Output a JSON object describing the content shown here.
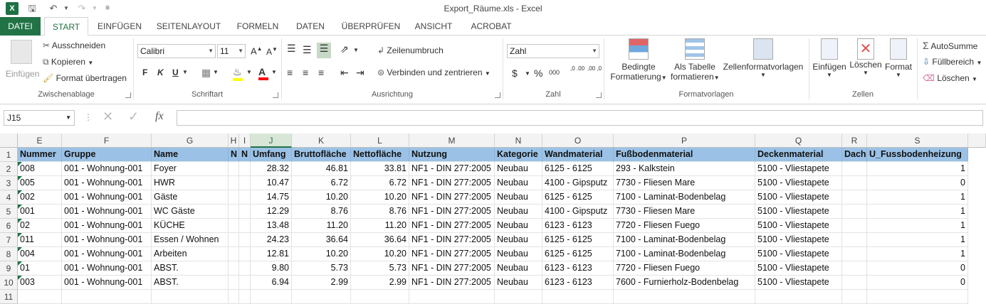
{
  "window": {
    "title": "Export_Räume.xls - Excel"
  },
  "tabs": [
    "DATEI",
    "START",
    "EINFÜGEN",
    "SEITENLAYOUT",
    "FORMELN",
    "DATEN",
    "ÜBERPRÜFEN",
    "ANSICHT",
    "ACROBAT"
  ],
  "ribbon": {
    "clipboard": {
      "paste": "Einfügen",
      "cut": "Ausschneiden",
      "copy": "Kopieren",
      "format_painter": "Format übertragen",
      "label": "Zwischenablage"
    },
    "font": {
      "name": "Calibri",
      "size": "11",
      "bold": "F",
      "italic": "K",
      "underline": "U",
      "label": "Schriftart"
    },
    "alignment": {
      "wrap": "Zeilenumbruch",
      "merge": "Verbinden und zentrieren",
      "label": "Ausrichtung"
    },
    "number": {
      "format": "Zahl",
      "currency": "$",
      "percent": "%",
      "thousands": "000",
      "inc_dec": ",0 .00",
      "dec_dec": ",00 ,0",
      "label": "Zahl"
    },
    "styles": {
      "cond_l1": "Bedingte",
      "cond_l2": "Formatierung",
      "table_l1": "Als Tabelle",
      "table_l2": "formatieren",
      "cell_styles": "Zellenformatvorlagen",
      "label": "Formatvorlagen"
    },
    "cells": {
      "insert": "Einfügen",
      "delete": "Löschen",
      "format": "Format",
      "label": "Zellen"
    },
    "editing": {
      "autosum": "AutoSumme",
      "fill": "Füllbereich",
      "clear": "Löschen"
    }
  },
  "formula_bar": {
    "name_box": "J15",
    "fx": "fx",
    "value": ""
  },
  "columns": [
    {
      "letter": "E",
      "header": "Nummer"
    },
    {
      "letter": "F",
      "header": "Gruppe"
    },
    {
      "letter": "G",
      "header": "Name"
    },
    {
      "letter": "H",
      "header": "N"
    },
    {
      "letter": "I",
      "header": "N"
    },
    {
      "letter": "J",
      "header": "Umfang"
    },
    {
      "letter": "K",
      "header": "Bruttofläche"
    },
    {
      "letter": "L",
      "header": "Nettofläche"
    },
    {
      "letter": "M",
      "header": "Nutzung"
    },
    {
      "letter": "N",
      "header": "Kategorie"
    },
    {
      "letter": "O",
      "header": "Wandmaterial"
    },
    {
      "letter": "P",
      "header": "Fußbodenmaterial"
    },
    {
      "letter": "Q",
      "header": "Deckenmaterial"
    },
    {
      "letter": "R",
      "header": "Dach"
    },
    {
      "letter": "S",
      "header": "U_Fussbodenheizung"
    }
  ],
  "row_numbers": [
    "1",
    "2",
    "3",
    "4",
    "5",
    "6",
    "7",
    "8",
    "9",
    "10",
    "11"
  ],
  "rows": [
    [
      "008",
      "001 - Wohnung-001",
      "Foyer",
      "",
      "",
      "28.32",
      "46.81",
      "33.81",
      "NF1 - DIN 277:2005",
      "Neubau",
      "6125 - 6125",
      "293 - Kalkstein",
      "5100 - Vliestapete",
      "",
      "1"
    ],
    [
      "005",
      "001 - Wohnung-001",
      "HWR",
      "",
      "",
      "10.47",
      "6.72",
      "6.72",
      "NF1 - DIN 277:2005",
      "Neubau",
      "4100 - Gipsputz",
      "7730 - Fliesen Mare",
      "5100 - Vliestapete",
      "",
      "0"
    ],
    [
      "002",
      "001 - Wohnung-001",
      "Gäste",
      "",
      "",
      "14.75",
      "10.20",
      "10.20",
      "NF1 - DIN 277:2005",
      "Neubau",
      "6125 - 6125",
      "7100 - Laminat-Bodenbelag",
      "5100 - Vliestapete",
      "",
      "1"
    ],
    [
      "001",
      "001 - Wohnung-001",
      "WC Gäste",
      "",
      "",
      "12.29",
      "8.76",
      "8.76",
      "NF1 - DIN 277:2005",
      "Neubau",
      "4100 - Gipsputz",
      "7730 - Fliesen Mare",
      "5100 - Vliestapete",
      "",
      "1"
    ],
    [
      "02",
      "001 - Wohnung-001",
      "KÜCHE",
      "",
      "",
      "13.48",
      "11.20",
      "11.20",
      "NF1 - DIN 277:2005",
      "Neubau",
      "6123 - 6123",
      "7720 - Fliesen Fuego",
      "5100 - Vliestapete",
      "",
      "1"
    ],
    [
      "011",
      "001 - Wohnung-001",
      "Essen / Wohnen",
      "",
      "",
      "24.23",
      "36.64",
      "36.64",
      "NF1 - DIN 277:2005",
      "Neubau",
      "6125 - 6125",
      "7100 - Laminat-Bodenbelag",
      "5100 - Vliestapete",
      "",
      "1"
    ],
    [
      "004",
      "001 - Wohnung-001",
      "Arbeiten",
      "",
      "",
      "12.81",
      "10.20",
      "10.20",
      "NF1 - DIN 277:2005",
      "Neubau",
      "6125 - 6125",
      "7100 - Laminat-Bodenbelag",
      "5100 - Vliestapete",
      "",
      "1"
    ],
    [
      "01",
      "001 - Wohnung-001",
      "ABST.",
      "",
      "",
      "9.80",
      "5.73",
      "5.73",
      "NF1 - DIN 277:2005",
      "Neubau",
      "6123 - 6123",
      "7720 - Fliesen Fuego",
      "5100 - Vliestapete",
      "",
      "0"
    ],
    [
      "003",
      "001 - Wohnung-001",
      "ABST.",
      "",
      "",
      "6.94",
      "2.99",
      "2.99",
      "NF1 - DIN 277:2005",
      "Neubau",
      "6123 - 6123",
      "7600 - Furnierholz-Bodenbelag",
      "5100 - Vliestapete",
      "",
      "0"
    ]
  ],
  "colors": {
    "excel_green": "#217346",
    "header_fill": "#9bc2e6"
  }
}
